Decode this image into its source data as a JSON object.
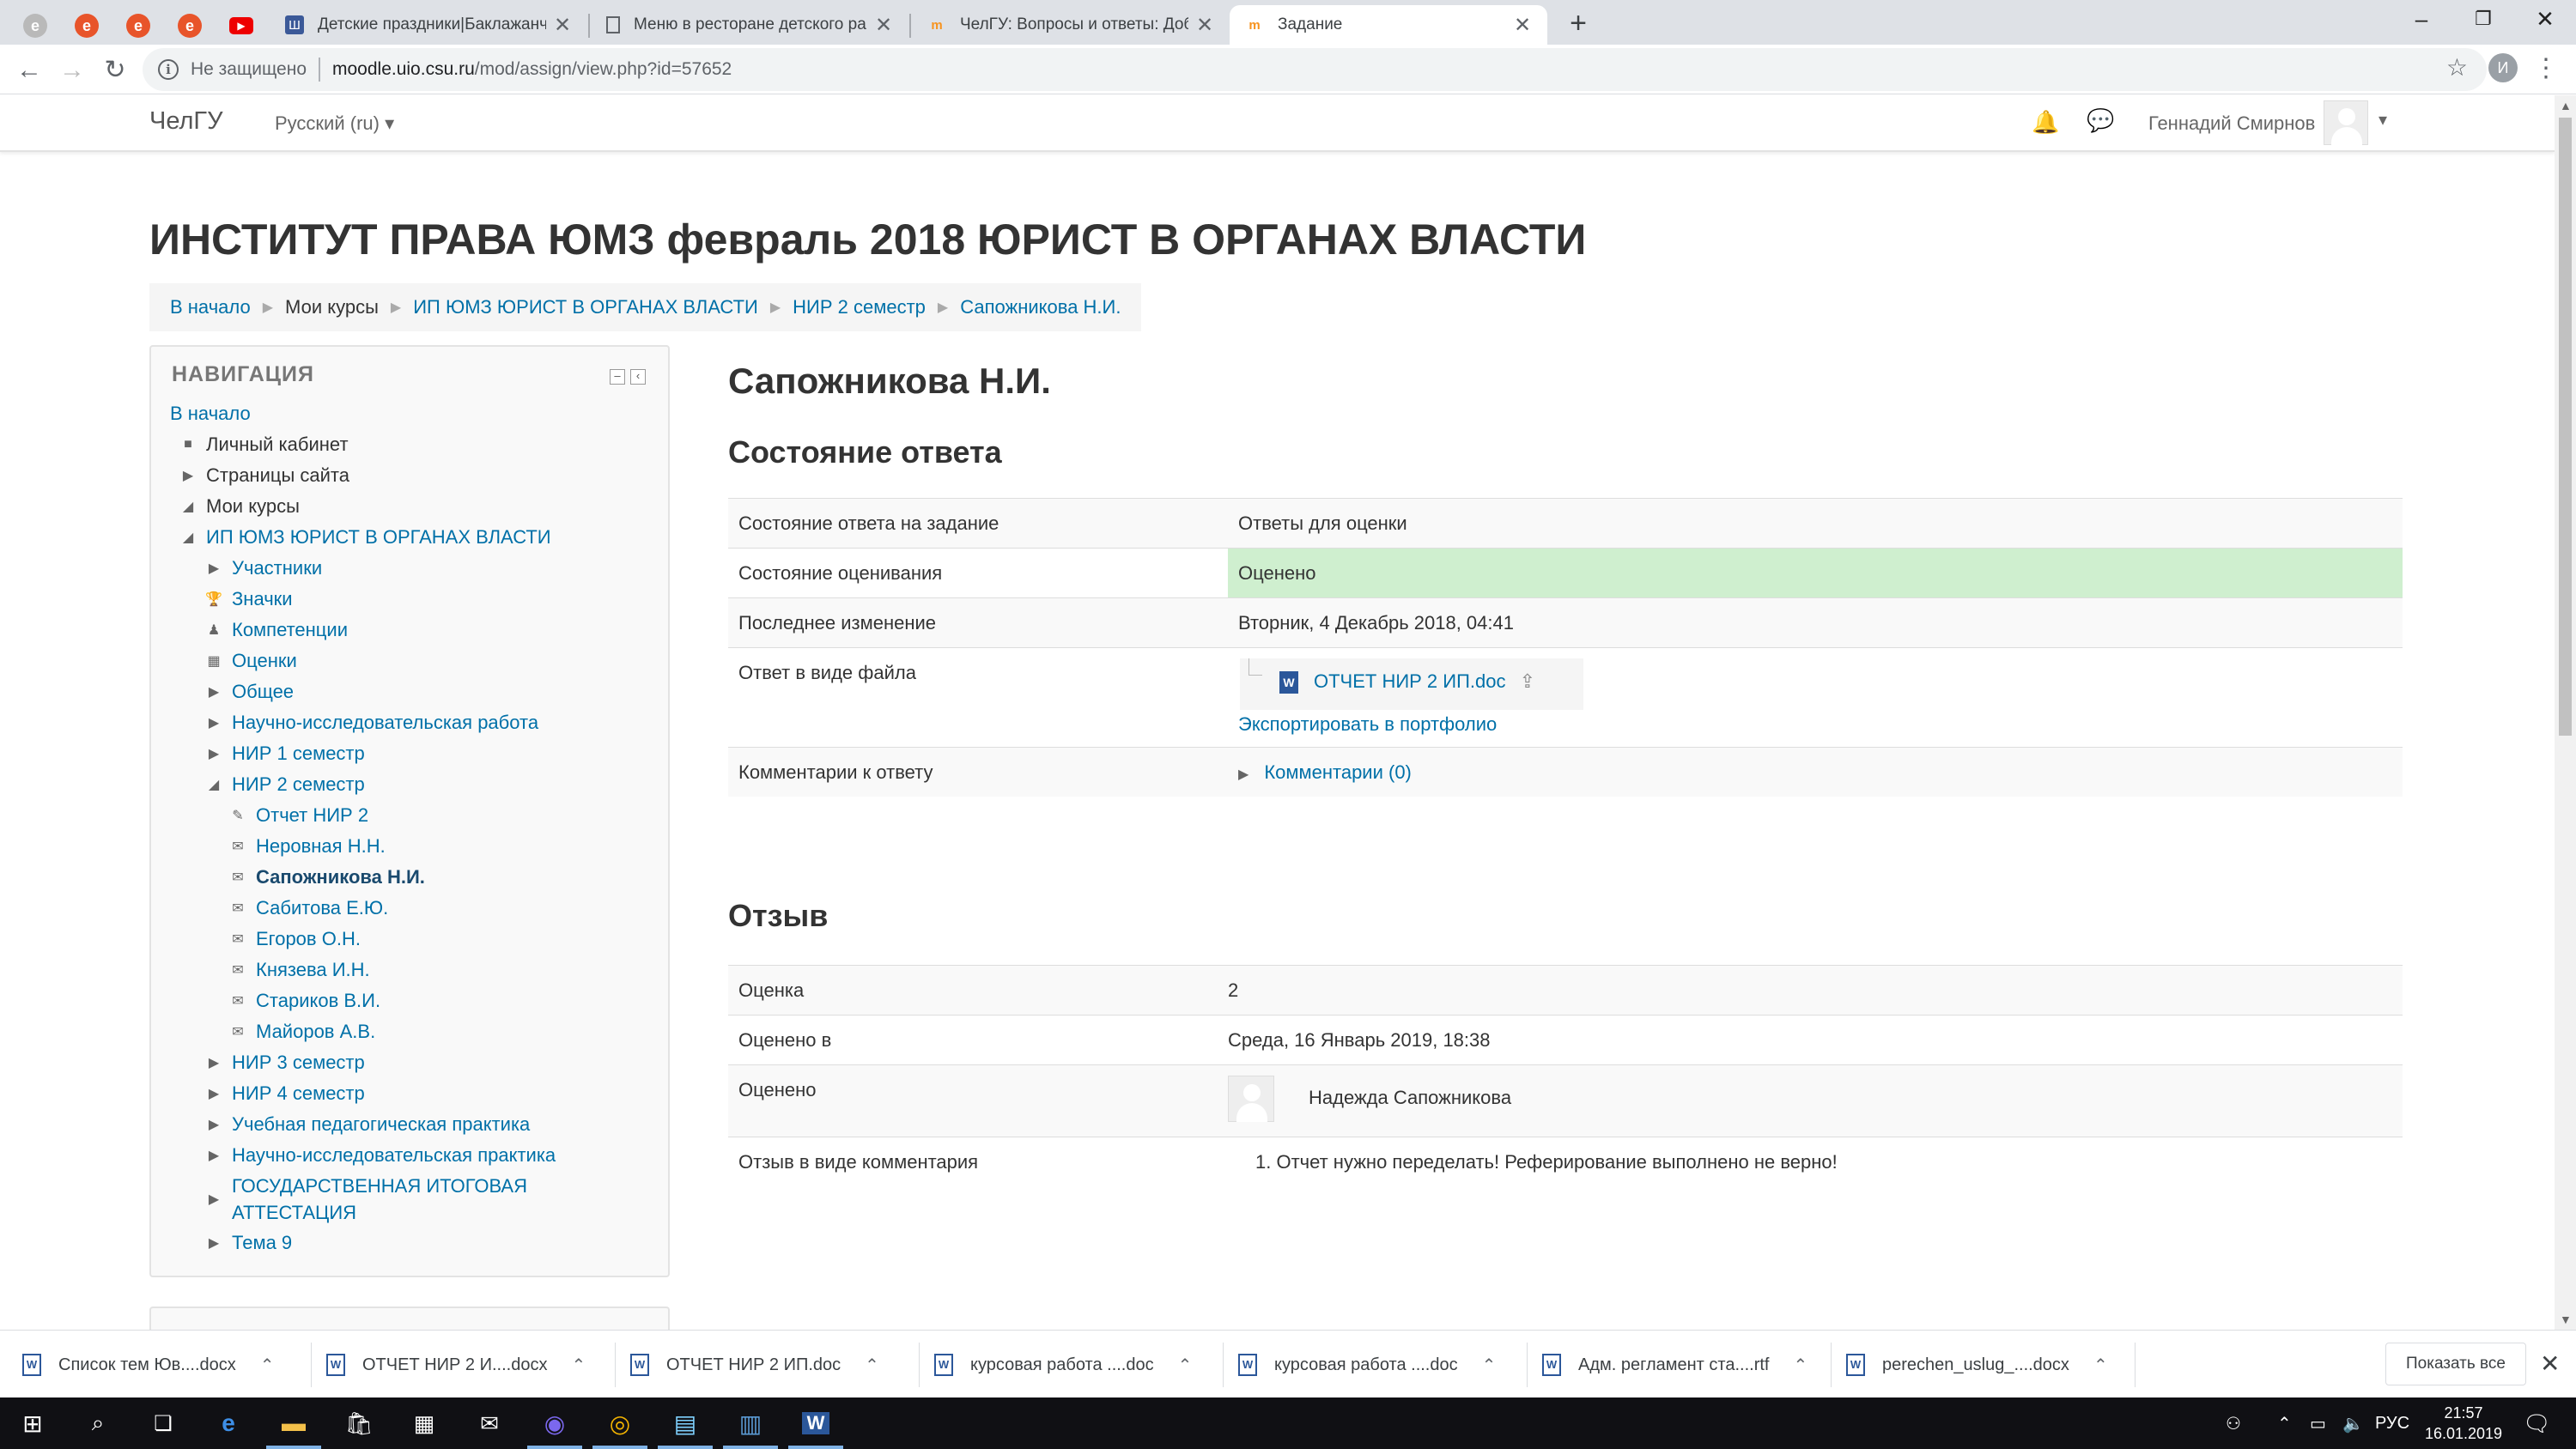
{
  "browser": {
    "tabs": [
      {
        "title": "Детские праздники|Баклажанчик",
        "favicon": "Ш",
        "active": false
      },
      {
        "title": "Меню в ресторане детского ра",
        "favicon": "doc",
        "active": false
      },
      {
        "title": "ЧелГУ: Вопросы и ответы: Доба",
        "favicon": "m",
        "active": false
      },
      {
        "title": "Задание",
        "favicon": "m",
        "active": true
      }
    ],
    "new_tab": "+",
    "not_secure": "Не защищено",
    "url_host": "moodle.uio.csu.ru",
    "url_path": "/mod/assign/view.php?id=57652",
    "profile_letter": "И"
  },
  "moodle": {
    "brand": "ЧелГУ",
    "language": "Русский (ru)",
    "user_name": "Геннадий Смирнов"
  },
  "page": {
    "course_title": "ИНСТИТУТ ПРАВА ЮМЗ февраль 2018 ЮРИСТ В ОРГАНАХ ВЛАСТИ",
    "breadcrumbs": [
      "В начало",
      "Мои курсы",
      "ИП ЮМЗ ЮРИСТ В ОРГАНАХ ВЛАСТИ",
      "НИР 2 семестр",
      "Сапожникова Н.И."
    ]
  },
  "navigation": {
    "title": "НАВИГАЦИЯ",
    "items": [
      {
        "label": "В начало",
        "level": 0,
        "icon": "",
        "style": "link"
      },
      {
        "label": "Личный кабинет",
        "level": 1,
        "icon": "■",
        "style": "plain"
      },
      {
        "label": "Страницы сайта",
        "level": 1,
        "icon": "▶",
        "style": "plain"
      },
      {
        "label": "Мои курсы",
        "level": 1,
        "icon": "◢",
        "style": "plain"
      },
      {
        "label": "ИП ЮМЗ ЮРИСТ В ОРГАНАХ ВЛАСТИ",
        "level": 2,
        "icon": "◢",
        "style": "link"
      },
      {
        "label": "Участники",
        "level": 3,
        "icon": "▶",
        "style": "link"
      },
      {
        "label": "Значки",
        "level": 3,
        "icon": "🏆",
        "style": "link"
      },
      {
        "label": "Компетенции",
        "level": 3,
        "icon": "♟",
        "style": "link"
      },
      {
        "label": "Оценки",
        "level": 3,
        "icon": "▦",
        "style": "link"
      },
      {
        "label": "Общее",
        "level": 3,
        "icon": "▶",
        "style": "link"
      },
      {
        "label": "Научно-исследовательская работа",
        "level": 3,
        "icon": "▶",
        "style": "link"
      },
      {
        "label": "НИР 1 семестр",
        "level": 3,
        "icon": "▶",
        "style": "link"
      },
      {
        "label": "НИР 2 семестр",
        "level": 3,
        "icon": "◢",
        "style": "link"
      },
      {
        "label": "Отчет НИР 2",
        "level": 4,
        "icon": "✎",
        "style": "link"
      },
      {
        "label": "Неровная Н.Н.",
        "level": 4,
        "icon": "✉",
        "style": "link"
      },
      {
        "label": "Сапожникова Н.И.",
        "level": 4,
        "icon": "✉",
        "style": "bold"
      },
      {
        "label": "Сабитова Е.Ю.",
        "level": 4,
        "icon": "✉",
        "style": "link"
      },
      {
        "label": "Егоров О.Н.",
        "level": 4,
        "icon": "✉",
        "style": "link"
      },
      {
        "label": "Князева И.Н.",
        "level": 4,
        "icon": "✉",
        "style": "link"
      },
      {
        "label": "Стариков В.И.",
        "level": 4,
        "icon": "✉",
        "style": "link"
      },
      {
        "label": "Майоров А.В.",
        "level": 4,
        "icon": "✉",
        "style": "link"
      },
      {
        "label": "НИР 3 семестр",
        "level": 3,
        "icon": "▶",
        "style": "link"
      },
      {
        "label": "НИР 4 семестр",
        "level": 3,
        "icon": "▶",
        "style": "link"
      },
      {
        "label": "Учебная педагогическая практика",
        "level": 3,
        "icon": "▶",
        "style": "link"
      },
      {
        "label": "Научно-исследовательская практика",
        "level": 3,
        "icon": "▶",
        "style": "link"
      },
      {
        "label": "ГОСУДАРСТВЕННАЯ ИТОГОВАЯ АТТЕСТАЦИЯ",
        "level": 3,
        "icon": "▶",
        "style": "link",
        "two_line": true
      },
      {
        "label": "Тема 9",
        "level": 3,
        "icon": "▶",
        "style": "link"
      }
    ]
  },
  "assignment": {
    "student": "Сапожникова Н.И.",
    "status_heading": "Состояние ответа",
    "status_rows": {
      "submission_label": "Состояние ответа на задание",
      "submission_value": "Ответы для оценки",
      "grading_label": "Состояние оценивания",
      "grading_value": "Оценено",
      "modified_label": "Последнее изменение",
      "modified_value": "Вторник, 4 Декабрь 2018, 04:41",
      "file_label": "Ответ в виде файла",
      "file_name": "ОТЧЕТ НИР 2 ИП.doc",
      "export_link": "Экспортировать в портфолио",
      "comments_label": "Комментарии к ответу",
      "comments_link": "Комментарии (0)"
    },
    "feedback_heading": "Отзыв",
    "feedback_rows": {
      "grade_label": "Оценка",
      "grade_value": "2",
      "graded_on_label": "Оценено в",
      "graded_on_value": "Среда, 16 Январь 2019, 18:38",
      "graded_by_label": "Оценено",
      "graded_by_value": "Надежда Сапожникова",
      "comment_label": "Отзыв в виде комментария",
      "comment_value": "1. Отчет нужно переделать! Реферирование выполнено не верно!"
    },
    "colors": {
      "graded_green": "#cfefcf",
      "link_blue": "#0070a8"
    }
  },
  "downloads": {
    "items": [
      "Список  тем Юв....docx",
      "ОТЧЕТ НИР 2 И....docx",
      "ОТЧЕТ НИР 2 ИП.doc",
      "курсовая работа ....doc",
      "курсовая работа ....doc",
      "Адм. регламент ста....rtf",
      "perechen_uslug_....docx"
    ],
    "show_all": "Показать все"
  },
  "taskbar": {
    "lang": "РУС",
    "time": "21:57",
    "date": "16.01.2019"
  }
}
